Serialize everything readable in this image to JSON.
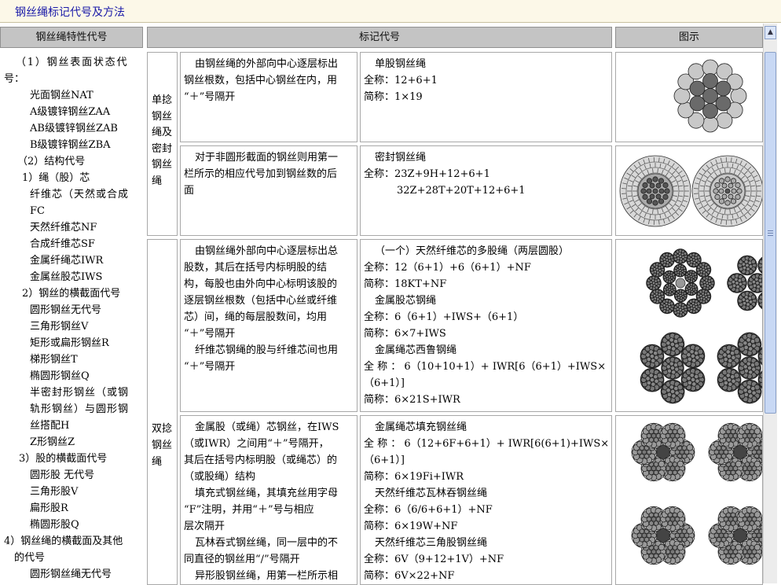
{
  "title": "钢丝绳标记代号及方法",
  "headers": {
    "col1": "钢丝绳特性代号",
    "col2": "标记代号",
    "col3": "图示"
  },
  "left_column": [
    "（1）钢丝表面状态代",
    "号：",
    "光面钢丝NAT",
    "A级镀锌钢丝ZAA",
    "AB级镀锌钢丝ZAB",
    "B级镀锌钢丝ZBA",
    "（2）结构代号",
    "1）绳（股）芯",
    "纤维芯（天然或合成",
    "FC",
    "天然纤维芯NF",
    "合成纤维芯SF",
    "金属纤绳芯IWR",
    "金属丝股芯IWS",
    "2）钢丝的横截面代号",
    "圆形钢丝无代号",
    "三角形钢丝V",
    "矩形或扁形钢丝R",
    "梯形钢丝T",
    "椭圆形钢丝Q",
    "半密封形钢丝（或钢",
    "轨形钢丝）与圆形钢",
    "丝搭配H",
    "Z形钢丝Z",
    "3）股的横截面代号",
    "圆形股 无代号",
    "三角形股V",
    "扁形股R",
    "椭圆形股Q",
    "4）钢丝绳的横截面及其他",
    "的代号",
    "圆形钢丝绳无代号"
  ],
  "rows": [
    {
      "category": [
        "单捻",
        "钢丝",
        "绳及",
        "密封",
        "钢丝",
        "绳"
      ],
      "items": [
        {
          "description": [
            "由钢丝绳的外部向中心逐层标出",
            "钢丝根数，包括中心钢丝在内，用",
            "“＋”号隔开"
          ],
          "marking": [
            "单股钢丝绳",
            "全称：12+6+1",
            "简称：1×19"
          ]
        },
        {
          "description": [
            "对于非圆形截面的钢丝则用第一",
            "栏所示的相应代号加到钢丝数的后",
            "面"
          ],
          "marking": [
            "密封钢丝绳",
            "全称：23Z+9H+12+6+1",
            "32Z+28T+20T+12+6+1"
          ]
        }
      ]
    },
    {
      "category": [
        "双捻",
        "钢丝",
        "绳"
      ],
      "items": [
        {
          "description": [
            "由钢丝绳外部向中心逐层标出总",
            "股数，其后在括号内标明股的结",
            "构，每股也由外向中心标明该股的",
            "逐层钢丝根数（包括中心丝或纤维",
            "芯）间，绳的每层股数间，均用",
            "“＋”号隔开",
            "纤维芯钢绳的股与纤维芯间也用",
            "“＋”号隔开"
          ],
          "marking": [
            "（一个）天然纤维芯的多股绳（两层圆股）",
            "全称：12（6+1）+6（6+1）+NF",
            "简称：18KT+NF",
            "金属股芯钢绳",
            "全称：6（6+1）+IWS+（6+1）",
            "简称：6×7+IWS",
            "金属绳芯西鲁钢绳",
            "全 称 ： 6（10+10+1）+ IWR[6（6+1）+IWS×",
            "（6+1）]",
            "简称：6×21S+IWR"
          ]
        },
        {
          "description": [
            "金属股（或绳）芯钢丝，在IWS",
            "（或IWR）之间用“＋”号隔开，",
            "其后在括号内标明股（或绳芯）的",
            "（或股绳）结构",
            "填充式钢丝绳，其填充丝用字母",
            "“F”注明，并用“＋”号与相应",
            "层次隔开",
            "瓦林吞式钢丝绳，同一层中的不",
            "同直径的钢丝用“/”号隔开",
            "异形股钢丝绳，用第一栏所示相"
          ],
          "marking": [
            "金属绳芯填充钢丝绳",
            "全 称 ： 6（12+6F+6+1）+ IWR[6(6+1)+IWS×",
            "（6+1）]",
            "简称：6×19Fi+IWR",
            "天然纤维芯瓦林吞钢丝绳",
            "全称：6（6/6+6+1）+NF",
            "简称：6×19W+NF",
            "天然纤维芯三角股钢丝绳",
            "全称：6V（9+12+1V）+NF",
            "简称：6V×22+NF"
          ]
        }
      ]
    }
  ],
  "illustrations": [
    "single-strand-cross-section-icon",
    "locked-coil-rope-cross-section-icon",
    "multi-strand-rope-cross-section-icon",
    "filler-warrington-rope-cross-section-icon"
  ],
  "colors": {
    "title_text": "#1a1aa8",
    "title_bg": "#fcf8e8",
    "header_bg": "#c4c4c4",
    "border": "#a8a8a8",
    "wire": "#6a6a6a"
  }
}
